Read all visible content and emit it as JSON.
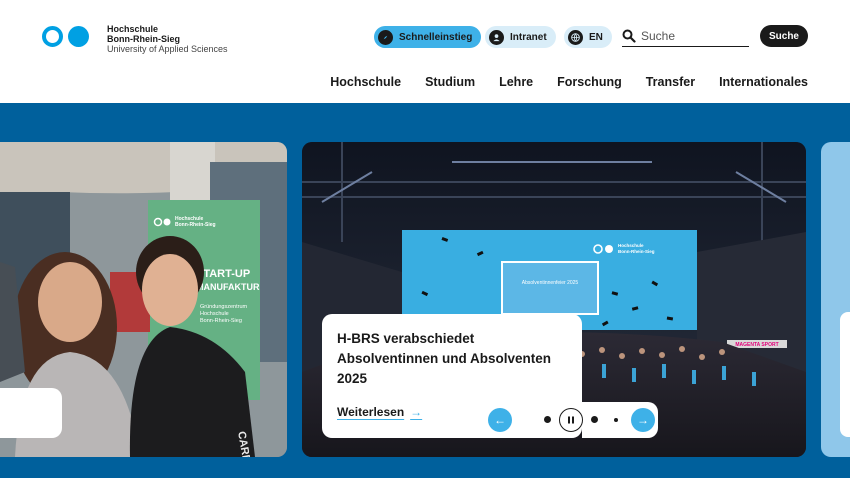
{
  "logo": {
    "line1": "Hochschule",
    "line2": "Bonn-Rhein-Sieg",
    "line3": "University of Applied Sciences",
    "icon": "hbrs-logo-dots"
  },
  "utility": {
    "schnelleinstieg": "Schnelleinstieg",
    "intranet": "Intranet",
    "language": "EN"
  },
  "search": {
    "placeholder": "Suche",
    "button": "Suche"
  },
  "nav": [
    "Hochschule",
    "Studium",
    "Lehre",
    "Forschung",
    "Transfer",
    "Internationales"
  ],
  "hero": {
    "left_banner_lines": [
      "Hochschule",
      "Bonn-Rhein-Sieg",
      "START-UP",
      "MANUFAKTUR",
      "Gründungszentrum",
      "Hochschule",
      "Bonn-Rhein-Sieg"
    ],
    "stage_screen_text": "Absolventinnenfeier 2025",
    "stage_banner_lines": [
      "Hochschule",
      "Bonn-Rhein-Sieg"
    ],
    "sponsor_text": "MAGENTA SPORT",
    "news": {
      "title": "H-BRS verabschiedet Absolventinnen und Absolventen 2025",
      "link": "Weiterlesen",
      "link_arrow": "→"
    },
    "controls": {
      "prev": "←",
      "next": "→",
      "total_slides": 4,
      "current_slide": 2
    }
  },
  "colors": {
    "accent": "#3eb1e8",
    "hero_bg": "#00609c",
    "logo": "#00a0e3",
    "dark": "#1a1a1a"
  }
}
